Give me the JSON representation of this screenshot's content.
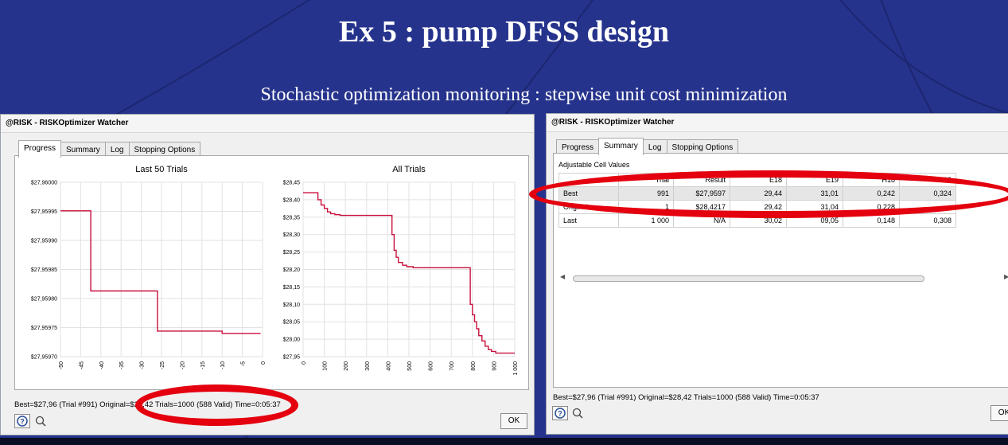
{
  "slide": {
    "title": "Ex 5 : pump DFSS design",
    "subtitle": "Stochastic optimization monitoring : stepwise unit cost minimization"
  },
  "left_window": {
    "title": "@RISK - RISKOptimizer Watcher",
    "tabs": [
      {
        "label": "Progress",
        "active": true
      },
      {
        "label": "Summary",
        "active": false
      },
      {
        "label": "Log",
        "active": false
      },
      {
        "label": "Stopping Options",
        "active": false
      }
    ],
    "status": "Best=$27,96 (Trial #991) Original=$28,42 Trials=1000 (588 Valid) Time=0:05:37",
    "ok_label": "OK",
    "help_icon": "help-icon",
    "zoom_icon": "zoom-icon"
  },
  "right_window": {
    "title": "@RISK - RISKOptimizer Watcher",
    "tabs": [
      {
        "label": "Progress",
        "active": false
      },
      {
        "label": "Summary",
        "active": true
      },
      {
        "label": "Log",
        "active": false
      },
      {
        "label": "Stopping Options",
        "active": false
      }
    ],
    "section_label": "Adjustable Cell Values",
    "columns": [
      "",
      "Trial",
      "Result",
      "E18",
      "E19",
      "H18",
      "H19"
    ],
    "rows": [
      [
        "Best",
        "991",
        "$27,9597",
        "29,44",
        "31,01",
        "0,242",
        "0,324"
      ],
      [
        "Original",
        "1",
        "$28,4217",
        "29,42",
        "31,04",
        "0,228",
        ""
      ],
      [
        "Last",
        "1 000",
        "N/A",
        "30,02",
        "09,05",
        "0,148",
        "0,308"
      ]
    ],
    "status": "Best=$27,96 (Trial #991) Original=$28,42 Trials=1000 (588 Valid) Time=0:05:37",
    "ok_label": "OK"
  },
  "chart_data": [
    {
      "type": "line",
      "title": "Last 50 Trials",
      "xlim": [
        -50,
        0
      ],
      "ylim": [
        27.9597,
        27.96
      ],
      "x_ticks": [
        -50,
        -45,
        -40,
        -35,
        -30,
        -25,
        -20,
        -15,
        -10,
        -5,
        0
      ],
      "y_ticks": [
        "$27,95970",
        "$27,95975",
        "$27,95980",
        "$27,95985",
        "$27,95990",
        "$27,95995",
        "$27,96000"
      ],
      "y_tick_values": [
        27.9597,
        27.95975,
        27.9598,
        27.95985,
        27.9599,
        27.95995,
        27.96
      ],
      "grid": true,
      "color": "#c8103c",
      "series": [
        {
          "x": [
            -50,
            -42.5,
            -42.5,
            -26,
            -26,
            -10,
            -10,
            -0.5
          ],
          "y": [
            27.959951,
            27.959951,
            27.959813,
            27.959813,
            27.959744,
            27.959744,
            27.95974,
            27.95974
          ]
        }
      ]
    },
    {
      "type": "line",
      "title": "All Trials",
      "xlim": [
        0,
        1000
      ],
      "ylim": [
        27.95,
        28.45
      ],
      "x_ticks": [
        "0",
        "100",
        "200",
        "300",
        "400",
        "500",
        "600",
        "700",
        "800",
        "900",
        "1 000"
      ],
      "x_tick_values": [
        0,
        100,
        200,
        300,
        400,
        500,
        600,
        700,
        800,
        900,
        1000
      ],
      "y_ticks": [
        "$27,95",
        "$28,00",
        "$28,05",
        "$28,10",
        "$28,15",
        "$28,20",
        "$28,25",
        "$28,30",
        "$28,35",
        "$28,40",
        "$28,45"
      ],
      "y_tick_values": [
        27.95,
        28.0,
        28.05,
        28.1,
        28.15,
        28.2,
        28.25,
        28.3,
        28.35,
        28.4,
        28.45
      ],
      "grid": true,
      "color": "#c8103c",
      "series": [
        {
          "x": [
            0,
            70,
            70,
            85,
            85,
            100,
            100,
            115,
            115,
            130,
            130,
            150,
            150,
            175,
            175,
            420,
            420,
            430,
            430,
            440,
            440,
            450,
            450,
            470,
            470,
            490,
            490,
            520,
            520,
            790,
            790,
            800,
            800,
            810,
            810,
            820,
            820,
            830,
            830,
            845,
            845,
            860,
            860,
            875,
            875,
            890,
            890,
            910,
            910,
            1000
          ],
          "y": [
            28.42,
            28.42,
            28.4,
            28.4,
            28.385,
            28.385,
            28.375,
            28.375,
            28.365,
            28.365,
            28.36,
            28.36,
            28.357,
            28.357,
            28.355,
            28.355,
            28.3,
            28.3,
            28.255,
            28.255,
            28.235,
            28.235,
            28.22,
            28.22,
            28.212,
            28.212,
            28.208,
            28.208,
            28.205,
            28.205,
            28.1,
            28.1,
            28.07,
            28.07,
            28.05,
            28.05,
            28.03,
            28.03,
            28.01,
            28.01,
            27.995,
            27.995,
            27.98,
            27.98,
            27.97,
            27.97,
            27.965,
            27.965,
            27.96,
            27.96
          ]
        }
      ]
    }
  ]
}
